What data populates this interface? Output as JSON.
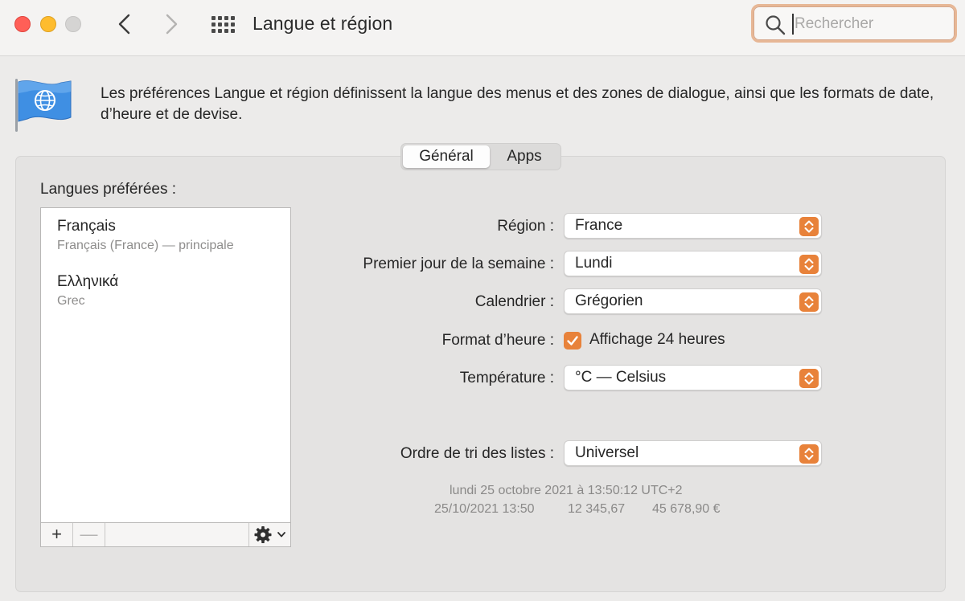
{
  "window": {
    "title": "Langue et région"
  },
  "toolbar": {
    "back_icon": "chevron-left-icon",
    "forward_icon": "chevron-right-icon",
    "grid_icon": "grid-icon",
    "search_placeholder": "Rechercher",
    "search_value": "",
    "accent_color": "#e8823a"
  },
  "header": {
    "icon": "globe-flag-icon",
    "description": "Les préférences Langue et région définissent la langue des menus et des zones de dialogue, ainsi que les formats de date, d’heure et de devise."
  },
  "tabs": [
    {
      "label": "Général",
      "selected": true
    },
    {
      "label": "Apps",
      "selected": false
    }
  ],
  "languages": {
    "label": "Langues préférées :",
    "items": [
      {
        "name": "Français",
        "detail": "Français (France) — principale"
      },
      {
        "name": "Ελληνικά",
        "detail": "Grec"
      }
    ],
    "add_label": "+",
    "remove_label": "—",
    "gear_icon": "gear-icon"
  },
  "settings": {
    "region": {
      "label": "Région :",
      "value": "France"
    },
    "first_day": {
      "label": "Premier jour de la semaine :",
      "value": "Lundi"
    },
    "calendar": {
      "label": "Calendrier :",
      "value": "Grégorien"
    },
    "time_format": {
      "label": "Format d’heure :",
      "checkbox_label": "Affichage 24 heures",
      "checked": true
    },
    "temperature": {
      "label": "Température :",
      "value": "°C — Celsius"
    },
    "sort_order": {
      "label": "Ordre de tri des listes :",
      "value": "Universel"
    }
  },
  "samples": {
    "long_date": "lundi 25 octobre 2021 à 13:50:12 UTC+2",
    "short_date": "25/10/2021 13:50",
    "number": "12 345,67",
    "currency": "45 678,90 €"
  }
}
